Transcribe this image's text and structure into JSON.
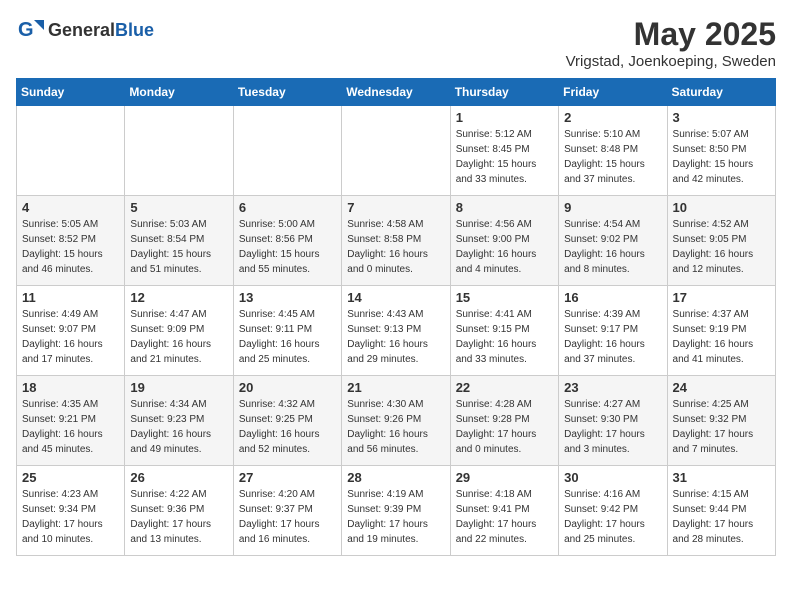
{
  "header": {
    "logo_general": "General",
    "logo_blue": "Blue",
    "month_title": "May 2025",
    "location": "Vrigstad, Joenkoeping, Sweden"
  },
  "weekdays": [
    "Sunday",
    "Monday",
    "Tuesday",
    "Wednesday",
    "Thursday",
    "Friday",
    "Saturday"
  ],
  "weeks": [
    [
      {
        "day": "",
        "info": ""
      },
      {
        "day": "",
        "info": ""
      },
      {
        "day": "",
        "info": ""
      },
      {
        "day": "",
        "info": ""
      },
      {
        "day": "1",
        "info": "Sunrise: 5:12 AM\nSunset: 8:45 PM\nDaylight: 15 hours\nand 33 minutes."
      },
      {
        "day": "2",
        "info": "Sunrise: 5:10 AM\nSunset: 8:48 PM\nDaylight: 15 hours\nand 37 minutes."
      },
      {
        "day": "3",
        "info": "Sunrise: 5:07 AM\nSunset: 8:50 PM\nDaylight: 15 hours\nand 42 minutes."
      }
    ],
    [
      {
        "day": "4",
        "info": "Sunrise: 5:05 AM\nSunset: 8:52 PM\nDaylight: 15 hours\nand 46 minutes."
      },
      {
        "day": "5",
        "info": "Sunrise: 5:03 AM\nSunset: 8:54 PM\nDaylight: 15 hours\nand 51 minutes."
      },
      {
        "day": "6",
        "info": "Sunrise: 5:00 AM\nSunset: 8:56 PM\nDaylight: 15 hours\nand 55 minutes."
      },
      {
        "day": "7",
        "info": "Sunrise: 4:58 AM\nSunset: 8:58 PM\nDaylight: 16 hours\nand 0 minutes."
      },
      {
        "day": "8",
        "info": "Sunrise: 4:56 AM\nSunset: 9:00 PM\nDaylight: 16 hours\nand 4 minutes."
      },
      {
        "day": "9",
        "info": "Sunrise: 4:54 AM\nSunset: 9:02 PM\nDaylight: 16 hours\nand 8 minutes."
      },
      {
        "day": "10",
        "info": "Sunrise: 4:52 AM\nSunset: 9:05 PM\nDaylight: 16 hours\nand 12 minutes."
      }
    ],
    [
      {
        "day": "11",
        "info": "Sunrise: 4:49 AM\nSunset: 9:07 PM\nDaylight: 16 hours\nand 17 minutes."
      },
      {
        "day": "12",
        "info": "Sunrise: 4:47 AM\nSunset: 9:09 PM\nDaylight: 16 hours\nand 21 minutes."
      },
      {
        "day": "13",
        "info": "Sunrise: 4:45 AM\nSunset: 9:11 PM\nDaylight: 16 hours\nand 25 minutes."
      },
      {
        "day": "14",
        "info": "Sunrise: 4:43 AM\nSunset: 9:13 PM\nDaylight: 16 hours\nand 29 minutes."
      },
      {
        "day": "15",
        "info": "Sunrise: 4:41 AM\nSunset: 9:15 PM\nDaylight: 16 hours\nand 33 minutes."
      },
      {
        "day": "16",
        "info": "Sunrise: 4:39 AM\nSunset: 9:17 PM\nDaylight: 16 hours\nand 37 minutes."
      },
      {
        "day": "17",
        "info": "Sunrise: 4:37 AM\nSunset: 9:19 PM\nDaylight: 16 hours\nand 41 minutes."
      }
    ],
    [
      {
        "day": "18",
        "info": "Sunrise: 4:35 AM\nSunset: 9:21 PM\nDaylight: 16 hours\nand 45 minutes."
      },
      {
        "day": "19",
        "info": "Sunrise: 4:34 AM\nSunset: 9:23 PM\nDaylight: 16 hours\nand 49 minutes."
      },
      {
        "day": "20",
        "info": "Sunrise: 4:32 AM\nSunset: 9:25 PM\nDaylight: 16 hours\nand 52 minutes."
      },
      {
        "day": "21",
        "info": "Sunrise: 4:30 AM\nSunset: 9:26 PM\nDaylight: 16 hours\nand 56 minutes."
      },
      {
        "day": "22",
        "info": "Sunrise: 4:28 AM\nSunset: 9:28 PM\nDaylight: 17 hours\nand 0 minutes."
      },
      {
        "day": "23",
        "info": "Sunrise: 4:27 AM\nSunset: 9:30 PM\nDaylight: 17 hours\nand 3 minutes."
      },
      {
        "day": "24",
        "info": "Sunrise: 4:25 AM\nSunset: 9:32 PM\nDaylight: 17 hours\nand 7 minutes."
      }
    ],
    [
      {
        "day": "25",
        "info": "Sunrise: 4:23 AM\nSunset: 9:34 PM\nDaylight: 17 hours\nand 10 minutes."
      },
      {
        "day": "26",
        "info": "Sunrise: 4:22 AM\nSunset: 9:36 PM\nDaylight: 17 hours\nand 13 minutes."
      },
      {
        "day": "27",
        "info": "Sunrise: 4:20 AM\nSunset: 9:37 PM\nDaylight: 17 hours\nand 16 minutes."
      },
      {
        "day": "28",
        "info": "Sunrise: 4:19 AM\nSunset: 9:39 PM\nDaylight: 17 hours\nand 19 minutes."
      },
      {
        "day": "29",
        "info": "Sunrise: 4:18 AM\nSunset: 9:41 PM\nDaylight: 17 hours\nand 22 minutes."
      },
      {
        "day": "30",
        "info": "Sunrise: 4:16 AM\nSunset: 9:42 PM\nDaylight: 17 hours\nand 25 minutes."
      },
      {
        "day": "31",
        "info": "Sunrise: 4:15 AM\nSunset: 9:44 PM\nDaylight: 17 hours\nand 28 minutes."
      }
    ]
  ]
}
